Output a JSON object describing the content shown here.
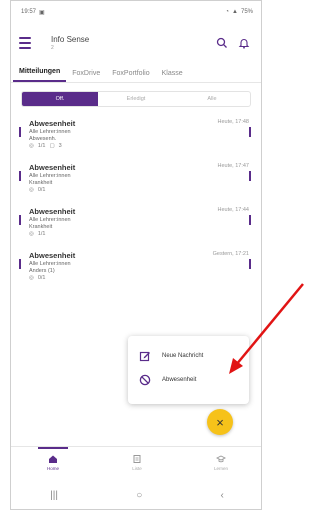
{
  "statusbar": {
    "time": "19:57",
    "battery": "75%"
  },
  "appbar": {
    "title": "Info Sense",
    "subtitle": "2"
  },
  "tabs": [
    "Mitteilungen",
    "FoxDrive",
    "FoxPortfolio",
    "Klasse"
  ],
  "filters": [
    "Off.",
    "Erledigt",
    "Alle"
  ],
  "messages": [
    {
      "subject": "Abwesenheit",
      "time": "Heute, 17:48",
      "to": "Alle Lehrer:innen",
      "info": "Abwesenh.",
      "read": "1/1",
      "comments": "3"
    },
    {
      "subject": "Abwesenheit",
      "time": "Heute, 17:47",
      "to": "Alle Lehrer:innen",
      "info": "Krankheit",
      "read": "0/1"
    },
    {
      "subject": "Abwesenheit",
      "time": "Heute, 17:44",
      "to": "Alle Lehrer:innen",
      "info": "Krankheit",
      "read": "1/1"
    },
    {
      "subject": "Abwesenheit",
      "time": "Gestern, 17:21",
      "to": "Alle Lehrer:innen",
      "info": "Anders (1)",
      "read": "0/1"
    }
  ],
  "popup": {
    "new_message": "Neue Nachricht",
    "absence": "Abwesenheit"
  },
  "bottomnav": [
    "Home",
    "Liste",
    "Lernen"
  ],
  "colors": {
    "primary": "#5a2c8a",
    "fab": "#f6c21a",
    "arrow": "#e11414"
  }
}
